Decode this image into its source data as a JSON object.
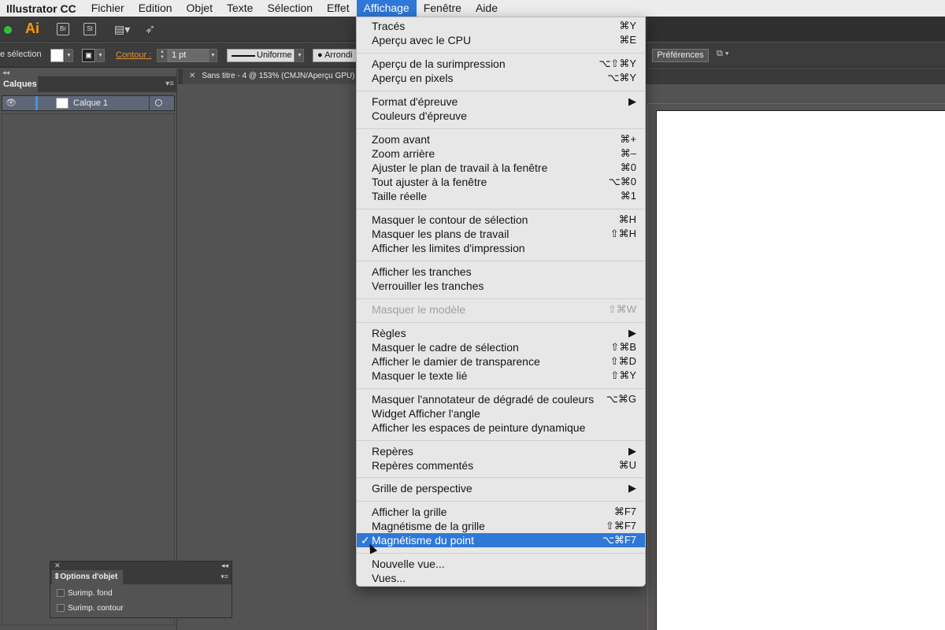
{
  "menubar": {
    "app": "Illustrator CC",
    "items": [
      "Fichier",
      "Edition",
      "Objet",
      "Texte",
      "Sélection",
      "Effet",
      "Affichage",
      "Fenêtre",
      "Aide"
    ],
    "active": "Affichage"
  },
  "appbar": {
    "logo": "Ai",
    "bridge": "Br",
    "stock": "St",
    "icons": [
      "workspace-icon",
      "send-icon"
    ]
  },
  "controlbar": {
    "selection_label": "e sélection",
    "contour_label": "Contour :",
    "stroke_weight": "1 pt",
    "profile": "Uniforme",
    "brush": "Arrondi",
    "preferences": "Préférences"
  },
  "layers_panel": {
    "title": "Calques",
    "layer_name": "Calque 1"
  },
  "document": {
    "tab_title": "Sans titre - 4 @ 153% (CMJN/Aperçu GPU)"
  },
  "view_menu": {
    "items": [
      {
        "label": "Tracés",
        "shortcut": "⌘Y"
      },
      {
        "label": "Aperçu avec le CPU",
        "shortcut": "⌘E"
      },
      {
        "label": "Aperçu de la surimpression",
        "shortcut": "⌥⇧⌘Y"
      },
      {
        "label": "Aperçu en pixels",
        "shortcut": "⌥⌘Y"
      },
      {
        "label": "Format d'épreuve",
        "shortcut": "▶"
      },
      {
        "label": "Couleurs d'épreuve",
        "shortcut": ""
      },
      {
        "label": "Zoom avant",
        "shortcut": "⌘+"
      },
      {
        "label": "Zoom arrière",
        "shortcut": "⌘–"
      },
      {
        "label": "Ajuster le plan de travail à la fenêtre",
        "shortcut": "⌘0"
      },
      {
        "label": "Tout ajuster à la fenêtre",
        "shortcut": "⌥⌘0"
      },
      {
        "label": "Taille réelle",
        "shortcut": "⌘1"
      },
      {
        "label": "Masquer le contour de sélection",
        "shortcut": "⌘H"
      },
      {
        "label": "Masquer les plans de travail",
        "shortcut": "⇧⌘H"
      },
      {
        "label": "Afficher les limites d'impression",
        "shortcut": ""
      },
      {
        "label": "Afficher les tranches",
        "shortcut": ""
      },
      {
        "label": "Verrouiller les tranches",
        "shortcut": ""
      },
      {
        "label": "Masquer le modèle",
        "shortcut": "⇧⌘W"
      },
      {
        "label": "Règles",
        "shortcut": "▶"
      },
      {
        "label": "Masquer le cadre de sélection",
        "shortcut": "⇧⌘B"
      },
      {
        "label": "Afficher le damier de transparence",
        "shortcut": "⇧⌘D"
      },
      {
        "label": "Masquer le texte lié",
        "shortcut": "⇧⌘Y"
      },
      {
        "label": "Masquer l'annotateur de dégradé de couleurs",
        "shortcut": "⌥⌘G"
      },
      {
        "label": "Widget Afficher l'angle",
        "shortcut": ""
      },
      {
        "label": "Afficher les espaces de peinture dynamique",
        "shortcut": ""
      },
      {
        "label": "Repères",
        "shortcut": "▶"
      },
      {
        "label": "Repères commentés",
        "shortcut": "⌘U"
      },
      {
        "label": "Grille de perspective",
        "shortcut": "▶"
      },
      {
        "label": "Afficher la grille",
        "shortcut": "⌘F7"
      },
      {
        "label": "Magnétisme de la grille",
        "shortcut": "⇧⌘F7"
      },
      {
        "label": "Magnétisme du point",
        "shortcut": "⌥⌘F7"
      },
      {
        "label": "Nouvelle vue...",
        "shortcut": ""
      },
      {
        "label": "Vues...",
        "shortcut": ""
      }
    ],
    "checkmark": "✓"
  },
  "options_panel": {
    "title": "Options d'objet",
    "fill_overprint": "Surimp. fond",
    "stroke_overprint": "Surimp. contour"
  },
  "colors": {
    "menu_highlight": "#2f78d8",
    "logo": "#ff9a00",
    "contour_label": "#e2903a",
    "bleed": "#c8413a"
  }
}
